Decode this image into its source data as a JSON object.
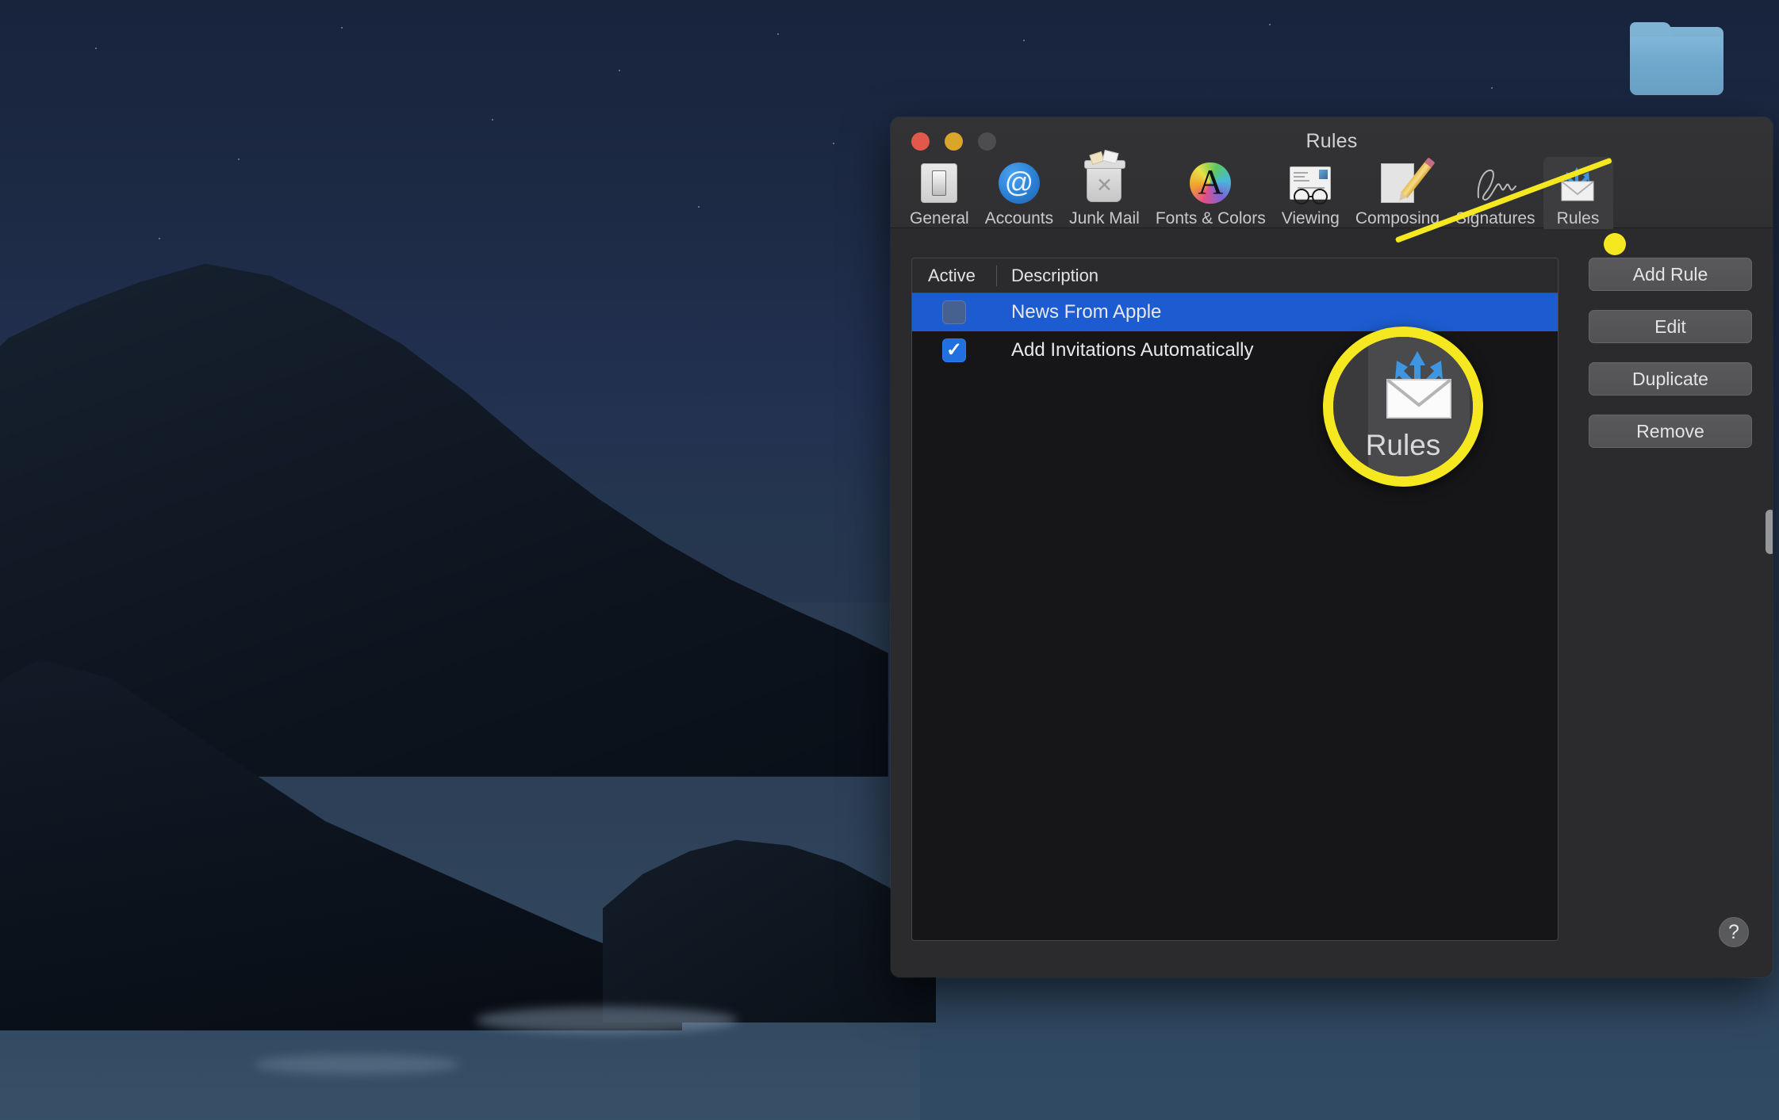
{
  "desktop": {
    "folder_icon": "folder-icon"
  },
  "window": {
    "title": "Rules",
    "traffic_lights": [
      {
        "name": "close",
        "color": "#e0594a"
      },
      {
        "name": "minimize",
        "color": "#d9a62b"
      },
      {
        "name": "zoom",
        "color": "#4d4d50"
      }
    ]
  },
  "toolbar": {
    "items": [
      {
        "label": "General",
        "icon": "general-switch-icon",
        "selected": false
      },
      {
        "label": "Accounts",
        "icon": "at-sign-icon",
        "selected": false
      },
      {
        "label": "Junk Mail",
        "icon": "trash-can-icon",
        "selected": false
      },
      {
        "label": "Fonts & Colors",
        "icon": "color-wheel-a-icon",
        "selected": false
      },
      {
        "label": "Viewing",
        "icon": "envelope-glasses-icon",
        "selected": false
      },
      {
        "label": "Composing",
        "icon": "paper-pencil-icon",
        "selected": false
      },
      {
        "label": "Signatures",
        "icon": "signature-icon",
        "selected": false
      },
      {
        "label": "Rules",
        "icon": "rules-envelope-arrows-icon",
        "selected": true
      }
    ]
  },
  "rules_table": {
    "columns": [
      "Active",
      "Description"
    ],
    "rows": [
      {
        "active": false,
        "description": "News From Apple",
        "selected": true
      },
      {
        "active": true,
        "description": "Add Invitations Automatically",
        "selected": false
      }
    ]
  },
  "buttons": {
    "add_rule": "Add Rule",
    "edit": "Edit",
    "duplicate": "Duplicate",
    "remove": "Remove",
    "help": "?"
  },
  "callout": {
    "magnified_label": "Rules",
    "ghost_text": "s",
    "highlight_color": "#f5e720"
  }
}
